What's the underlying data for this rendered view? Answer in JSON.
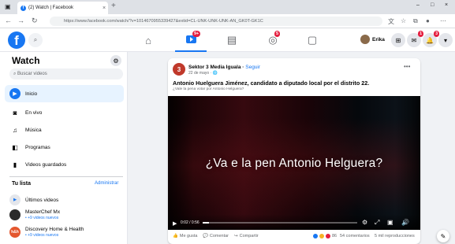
{
  "browser": {
    "tab_title": "(2) Watch | Facebook",
    "tab_close": "×",
    "new_tab": "+",
    "url": "https://www.facebook.com/watch/?v=1014670955339427&extid=CL-UNK-UNK-UNK-AN_GK0T-GK1C",
    "window_controls": [
      "–",
      "□",
      "×"
    ]
  },
  "fb_header": {
    "logo": "f",
    "watch_badge": "9+",
    "groups_badge": "5",
    "profile_name": "Erika",
    "messenger_badge": "1",
    "notif_badge": "3"
  },
  "sidebar": {
    "title": "Watch",
    "search_placeholder": "Buscar videos",
    "items": [
      {
        "label": "Inicio",
        "icon": "home-play-icon",
        "active": true
      },
      {
        "label": "En vivo",
        "icon": "live-icon",
        "active": false
      },
      {
        "label": "Música",
        "icon": "music-icon",
        "active": false
      },
      {
        "label": "Programas",
        "icon": "shows-icon",
        "active": false
      },
      {
        "label": "Videos guardados",
        "icon": "bookmark-icon",
        "active": false
      }
    ],
    "list_header": "Tu lista",
    "list_admin": "Administrar",
    "subscriptions": [
      {
        "name": "Últimos videos",
        "meta": ""
      },
      {
        "name": "MasterChef Mx",
        "meta": "• +9 videos nuevos"
      },
      {
        "name": "Discovery Home & Health",
        "meta": "• +9 videos nuevos"
      }
    ]
  },
  "post": {
    "page_name": "Sektor 3 Media Iguala",
    "follow": "Seguir",
    "date": "22 de mayo · 🌐",
    "title": "Antonio Huelguera Jiménez, candidato a diputado local por el distrito 22.",
    "subtitle": "¿Vale la pena votar por Antonio Helguera?",
    "video_headline": "¿Va e la pen  Antonio Helguera?",
    "video_time": "0:02 / 0:56",
    "video_progress": 0.04,
    "actions": {
      "like": "Me gusta",
      "comment": "Comentar",
      "share": "Compartir",
      "reactions_count": "86",
      "comments_count": "54 comentarios",
      "views": "5 mil reproducciones"
    }
  },
  "colors": {
    "brand": "#1877f2",
    "badge": "#e41e3f",
    "page_bg": "#f0f2f5"
  }
}
